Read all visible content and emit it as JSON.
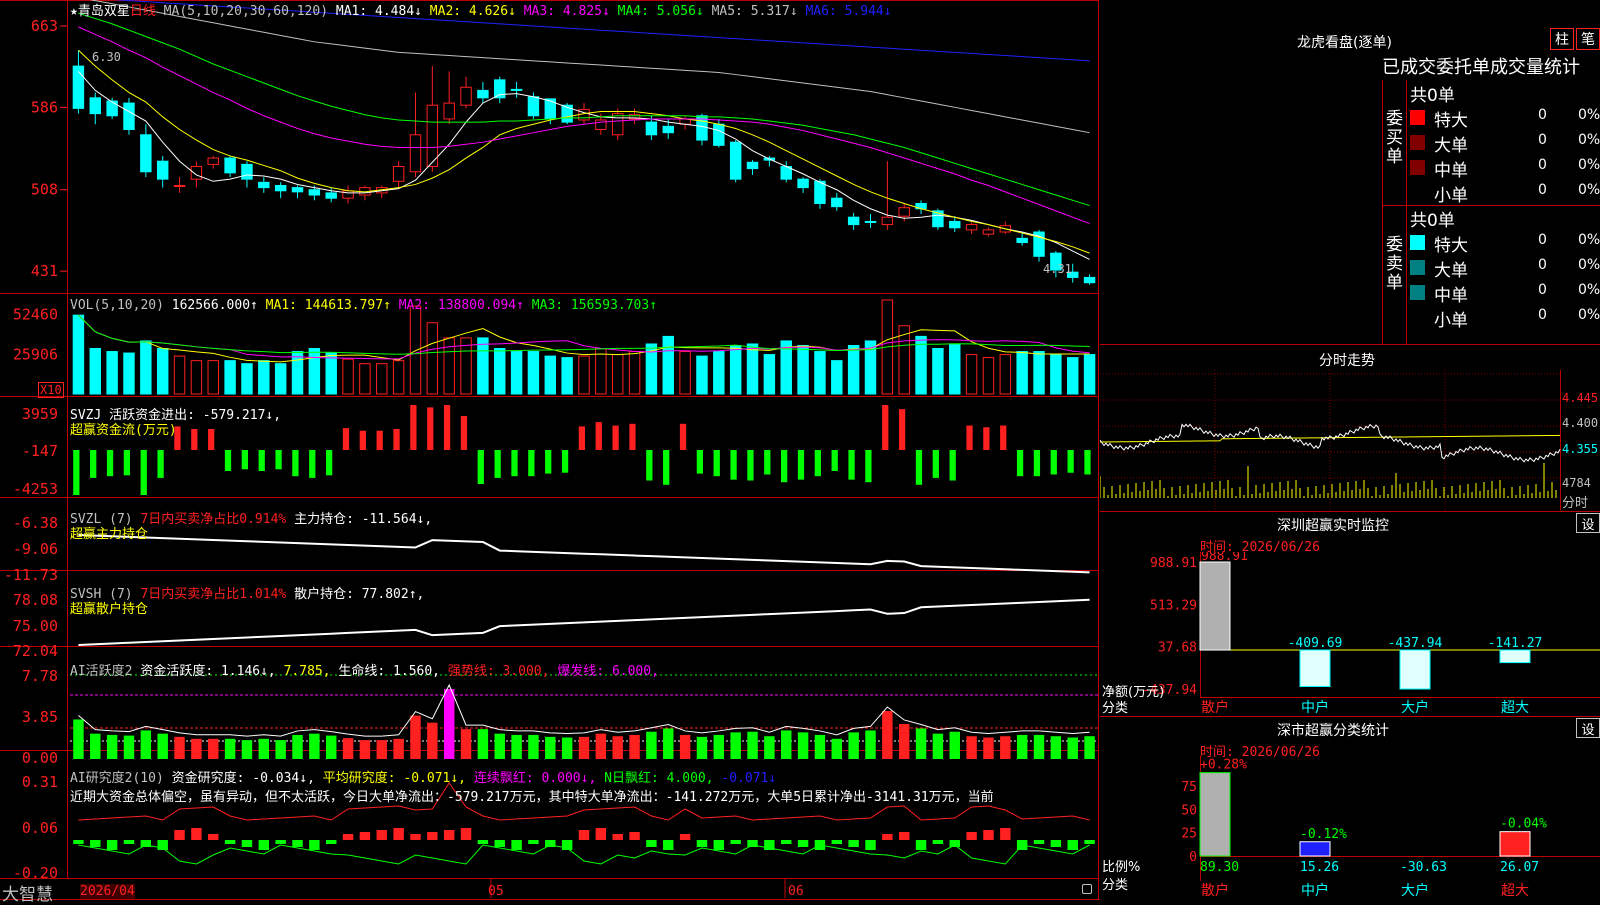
{
  "colors": {
    "up": "#ff2020",
    "down": "#00ffff",
    "grid": "#c00000",
    "white": "#ffffff",
    "yellow": "#ffff00",
    "magenta": "#ff00ff",
    "green": "#00ff00",
    "blue": "#2020ff",
    "gray": "#c0c0c0",
    "teal": "#008080",
    "darkred": "#800000"
  },
  "header": {
    "stock": "★青岛双星",
    "period": "日线",
    "ma_label": "MA(5,10,20,30,60,120)",
    "ma1": "MA1: 4.484↓",
    "ma2": "MA2: 4.626↓",
    "ma3": "MA3: 4.825↓",
    "ma4": "MA4: 5.056↓",
    "ma5": "MA5: 5.317↓",
    "ma6": "MA6: 5.944↓"
  },
  "price_panel": {
    "yticks": [
      "663",
      "586",
      "508",
      "431"
    ],
    "high_label": "6.30",
    "low_label": "4.31",
    "ylim": [
      415,
      680
    ]
  },
  "vol_panel": {
    "label": "VOL(5,10,20)",
    "value": "162566.000↑",
    "ma1": "MA1: 144613.797↑",
    "ma2": "MA2: 138800.094↑",
    "ma3": "MA3: 156593.703↑",
    "yticks": [
      "52460",
      "25906"
    ],
    "unit": "X10"
  },
  "svzj_panel": {
    "label": "SVZJ  活跃资金进出: -579.217↓,",
    "sub": "超赢资金流(万元)",
    "yticks": [
      "3959",
      "-147",
      "-4253"
    ]
  },
  "svzl_panel": {
    "label": "SVZL (7)",
    "desc": "7日内买卖净占比0.914%",
    "extra": "主力持仓: -11.564↓,",
    "sub": "超赢主力持仓",
    "yticks": [
      "-6.38",
      "-9.06",
      "-11.73"
    ]
  },
  "svsh_panel": {
    "label": "SVSH (7)",
    "desc": "7日内买卖净占比1.014%",
    "extra": "散户持仓: 77.802↑,",
    "sub": "超赢散户持仓",
    "yticks": [
      "78.08",
      "75.00",
      "72.04"
    ]
  },
  "ai_active": {
    "label": "AI活跃度2",
    "a": "资金活跃度: 1.146↓,",
    "b": "7.785,",
    "c": "生命线: 1.560,",
    "d": "强势线: 3.000,",
    "e": "爆发线: 6.000,",
    "yticks": [
      "7.78",
      "3.85",
      "0.00"
    ]
  },
  "ai_research": {
    "label": "AI研究度2(10)",
    "a": "资金研究度: -0.034↓,",
    "b": "平均研究度: -0.071↓,",
    "c": "连续飘红: 0.000↓,",
    "d": "N日飘红: 4.000,",
    "e": "-0.071↓",
    "text": "近期大资金总体偏空，虽有异动，但不太活跃，今日大单净流出：-579.217万元，其中特大单净流出：-141.272万元，大单5日累计净出-3141.31万元，当前",
    "yticks": [
      "0.31",
      "0.06",
      "-0.20"
    ]
  },
  "xaxis": {
    "labels": [
      "2026/04",
      "05",
      "06"
    ],
    "brand": "大智慧"
  },
  "dragon": {
    "title": "龙虎看盘(逐单)",
    "btn1": "柱",
    "btn2": "笔",
    "stat_title": "已成交委托单成交量统计",
    "buy_label": "委买单",
    "sell_label": "委卖单",
    "buy_total": "共0单",
    "sell_total": "共0单",
    "buy_rows": [
      {
        "name": "特大",
        "val": "0",
        "pct": "0%",
        "color": "#ff0000"
      },
      {
        "name": "大单",
        "val": "0",
        "pct": "0%",
        "color": "#800000"
      },
      {
        "name": "中单",
        "val": "0",
        "pct": "0%",
        "color": "#800000"
      },
      {
        "name": "小单",
        "val": "0",
        "pct": "0%",
        "color": ""
      }
    ],
    "sell_rows": [
      {
        "name": "特大",
        "val": "0",
        "pct": "0%",
        "color": "#00ffff"
      },
      {
        "name": "大单",
        "val": "0",
        "pct": "0%",
        "color": "#008080"
      },
      {
        "name": "中单",
        "val": "0",
        "pct": "0%",
        "color": "#008080"
      },
      {
        "name": "小单",
        "val": "0",
        "pct": "0%",
        "color": ""
      }
    ]
  },
  "intraday": {
    "title": "分时走势",
    "yticks": [
      "4.445",
      "4.400",
      "4.355"
    ],
    "vol_tick": "4784",
    "vol_label": "分时"
  },
  "sz_monitor": {
    "title": "深圳超赢实时监控",
    "btn": "设",
    "time": "时间: 2026/06/26",
    "yticks": [
      "988.91",
      "513.29",
      "37.68",
      "-437.94"
    ],
    "ylabel": "净额(万元)",
    "xlabel": "分类",
    "chart_data": {
      "type": "bar",
      "categories": [
        "散户",
        "中户",
        "大户",
        "超大"
      ],
      "values": [
        988.91,
        -409.69,
        -437.94,
        -141.27
      ],
      "labels": [
        "988.91",
        "-409.69",
        "-437.94",
        "-141.27"
      ]
    }
  },
  "sz_class": {
    "title": "深市超赢分类统计",
    "btn": "设",
    "time": "时间: 2026/06/26",
    "yticks": [
      "75",
      "50",
      "25",
      "0"
    ],
    "ylabel": "比例%",
    "xlabel": "分类",
    "chart_data": {
      "type": "bar",
      "categories": [
        "散户",
        "中户",
        "大户",
        "超大"
      ],
      "values": [
        89.3,
        15.26,
        -30.63,
        26.07
      ],
      "pct_labels": [
        "+0.28%",
        "-0.12%",
        "",
        "-0.04%"
      ],
      "value_labels": [
        "89.30",
        "15.26",
        "-30.63",
        "26.07"
      ]
    }
  },
  "chart_data": {
    "type": "candlestick",
    "x_start": "2026/04",
    "n": 61,
    "open": [
      625,
      595,
      592,
      590,
      560,
      535,
      512,
      518,
      532,
      538,
      532,
      515,
      512,
      510,
      508,
      505,
      500,
      503,
      505,
      516,
      525,
      530,
      575,
      588,
      602,
      612,
      603,
      596,
      594,
      588,
      574,
      565,
      560,
      575,
      572,
      568,
      570,
      578,
      570,
      553,
      534,
      538,
      530,
      518,
      516,
      500,
      482,
      478,
      475,
      483,
      495,
      488,
      478,
      470,
      466,
      468,
      462,
      468,
      448,
      430,
      425
    ],
    "close": [
      585,
      580,
      578,
      565,
      525,
      518,
      512,
      530,
      538,
      524,
      518,
      510,
      507,
      506,
      503,
      500,
      507,
      510,
      510,
      530,
      560,
      588,
      590,
      605,
      595,
      595,
      602,
      578,
      575,
      572,
      584,
      574,
      580,
      579,
      560,
      562,
      575,
      555,
      550,
      518,
      528,
      536,
      518,
      510,
      495,
      492,
      475,
      477,
      482,
      491,
      490,
      473,
      472,
      475,
      470,
      474,
      458,
      445,
      432,
      425,
      420
    ],
    "high": [
      640,
      600,
      595,
      595,
      570,
      540,
      520,
      535,
      540,
      540,
      535,
      520,
      515,
      512,
      512,
      510,
      512,
      512,
      512,
      535,
      600,
      625,
      620,
      615,
      610,
      615,
      610,
      600,
      590,
      590,
      590,
      580,
      585,
      585,
      578,
      575,
      578,
      580,
      575,
      555,
      536,
      540,
      535,
      520,
      518,
      505,
      486,
      485,
      535,
      495,
      498,
      490,
      483,
      477,
      472,
      478,
      468,
      470,
      450,
      438,
      428
    ],
    "low": [
      580,
      570,
      575,
      560,
      520,
      510,
      505,
      510,
      528,
      520,
      510,
      505,
      500,
      500,
      498,
      496,
      495,
      498,
      500,
      510,
      520,
      525,
      570,
      585,
      590,
      590,
      595,
      575,
      570,
      570,
      570,
      560,
      555,
      570,
      555,
      556,
      565,
      550,
      548,
      515,
      522,
      530,
      515,
      505,
      490,
      488,
      470,
      472,
      470,
      478,
      485,
      470,
      468,
      466,
      464,
      466,
      455,
      440,
      425,
      420,
      418
    ],
    "vol": [
      52000,
      30000,
      28000,
      27000,
      35000,
      30000,
      25000,
      22000,
      22000,
      22000,
      20000,
      22000,
      20000,
      28000,
      30000,
      27000,
      23000,
      20000,
      20000,
      22000,
      58000,
      47000,
      37000,
      37000,
      37000,
      30000,
      28000,
      28000,
      25000,
      24000,
      25000,
      30000,
      26000,
      28000,
      33000,
      38000,
      28000,
      25000,
      28000,
      32000,
      33000,
      26000,
      35000,
      32000,
      28000,
      22000,
      32000,
      35000,
      62000,
      45000,
      38000,
      30000,
      33000,
      26000,
      24000,
      26000,
      28000,
      28000,
      26000,
      24000,
      26000
    ],
    "ma5": [
      620,
      602,
      591,
      582,
      573,
      553,
      535,
      522,
      516,
      518,
      522,
      521,
      518,
      513,
      510,
      507,
      505,
      505,
      507,
      509,
      517,
      534,
      551,
      572,
      590,
      598,
      599,
      596,
      592,
      586,
      581,
      577,
      576,
      576,
      575,
      572,
      570,
      568,
      564,
      556,
      545,
      537,
      530,
      523,
      515,
      508,
      498,
      490,
      484,
      481,
      482,
      484,
      482,
      479,
      475,
      471,
      468,
      464,
      458,
      450,
      442
    ],
    "ma10": [
      640,
      625,
      612,
      600,
      591,
      577,
      565,
      555,
      546,
      540,
      536,
      531,
      526,
      519,
      514,
      510,
      507,
      506,
      508,
      510,
      513,
      519,
      527,
      538,
      548,
      560,
      566,
      570,
      574,
      577,
      580,
      582,
      582,
      582,
      580,
      578,
      575,
      573,
      570,
      566,
      560,
      553,
      545,
      537,
      529,
      521,
      513,
      506,
      500,
      495,
      490,
      486,
      482,
      478,
      475,
      471,
      467,
      463,
      459,
      454,
      448
    ],
    "ma20": [
      662,
      655,
      648,
      640,
      633,
      624,
      616,
      608,
      600,
      593,
      585,
      578,
      572,
      566,
      561,
      557,
      554,
      551,
      549,
      548,
      548,
      548,
      549,
      551,
      553,
      556,
      559,
      562,
      565,
      568,
      570,
      572,
      573,
      574,
      575,
      575,
      575,
      575,
      574,
      573,
      572,
      570,
      567,
      564,
      560,
      556,
      552,
      548,
      543,
      538,
      533,
      528,
      523,
      517,
      512,
      506,
      500,
      494,
      488,
      482,
      476
    ],
    "ma30": [
      675,
      670,
      665,
      659,
      653,
      647,
      641,
      634,
      627,
      621,
      615,
      609,
      603,
      597,
      592,
      587,
      583,
      579,
      576,
      574,
      573,
      572,
      572,
      572,
      572,
      573,
      573,
      574,
      575,
      576,
      576,
      577,
      578,
      578,
      578,
      578,
      578,
      577,
      577,
      576,
      575,
      573,
      571,
      569,
      566,
      563,
      560,
      556,
      552,
      548,
      543,
      538,
      533,
      528,
      523,
      518,
      513,
      508,
      503,
      498,
      493
    ],
    "ma60": [
      690,
      687,
      684,
      681,
      678,
      675,
      672,
      669,
      666,
      663,
      660,
      657,
      654,
      651,
      648,
      646,
      644,
      642,
      640,
      638,
      637,
      636,
      635,
      634,
      633,
      632,
      631,
      630,
      629,
      628,
      627,
      626,
      625,
      624,
      623,
      622,
      621,
      620,
      619,
      617,
      615,
      613,
      611,
      609,
      607,
      605,
      603,
      601,
      598,
      595,
      592,
      589,
      586,
      583,
      580,
      577,
      574,
      571,
      568,
      565,
      562
    ],
    "ma120": [
      690,
      689,
      688,
      687,
      686,
      685,
      684,
      683,
      682,
      681,
      680,
      679,
      678,
      677,
      676,
      675,
      674,
      673,
      672,
      671,
      670,
      669,
      668,
      667,
      666,
      665,
      664,
      663,
      662,
      661,
      660,
      659,
      658,
      657,
      656,
      655,
      654,
      653,
      652,
      651,
      650,
      649,
      648,
      647,
      646,
      645,
      644,
      643,
      642,
      641,
      640,
      639,
      638,
      637,
      636,
      635,
      634,
      633,
      632,
      631,
      630
    ]
  }
}
